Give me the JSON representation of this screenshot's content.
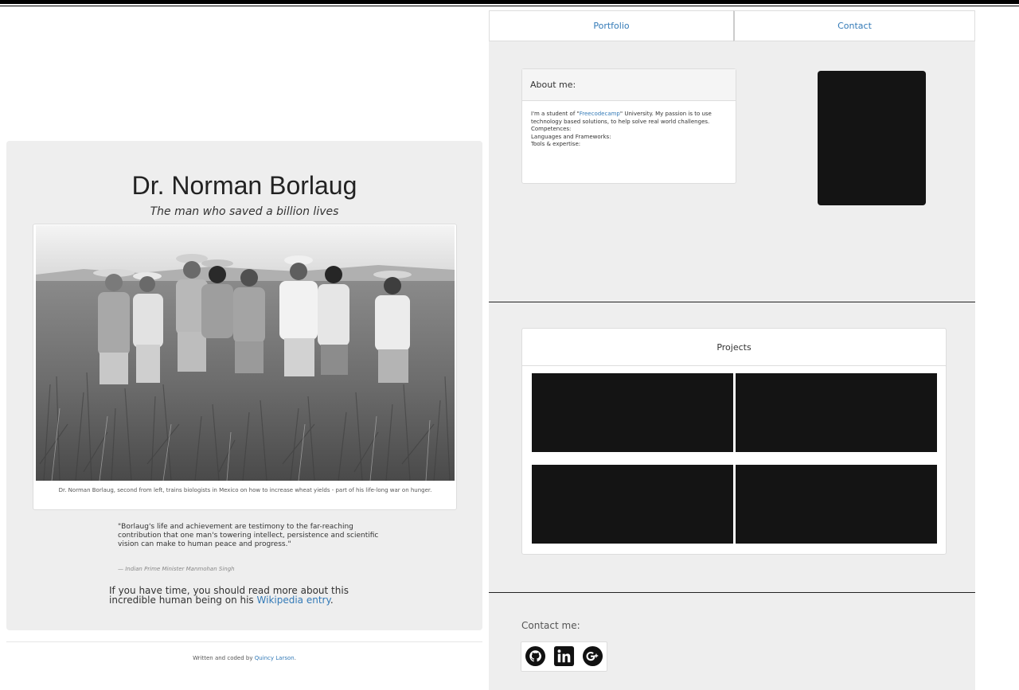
{
  "left": {
    "title": "Dr. Norman Borlaug",
    "subtitle": "The man who saved a billion lives",
    "caption": "Dr. Norman Borlaug, second from left, trains biologists in Mexico on how to increase wheat yields - part of his life-long war on hunger.",
    "quote": "\"Borlaug's life and achievement are testimony to the far-reaching contribution that one man's towering intellect, persistence and scientific vision can make to human peace and progress.\"",
    "quote_author": "— Indian Prime Minister Manmohan Singh",
    "more_info_prefix": "If you have time, you should read more about this incredible human being on his ",
    "more_info_link": "Wikipedia entry",
    "more_info_suffix": ".",
    "footer_prefix": "Written and coded by ",
    "footer_link": "Quincy Larson",
    "footer_suffix": "."
  },
  "nav": {
    "portfolio": "Portfolio",
    "contact": "Contact"
  },
  "about": {
    "heading": "About me:",
    "body_prefix": "I'm a student of \"",
    "body_link": "Freecodecamp",
    "body_suffix": "\" University. My passion is to use technology based solutions, to help solve real world challenges.",
    "competences": "Competences:",
    "languages": "Languages and Frameworks:",
    "tools": "Tools & expertise:"
  },
  "projects": {
    "heading": "Projects"
  },
  "contact": {
    "title": "Contact me:",
    "icons": [
      "github-icon",
      "linkedin-icon",
      "google-plus-icon"
    ]
  },
  "colors": {
    "link": "#337ab7",
    "panel": "#eeeeee",
    "dark_tile": "#141414"
  }
}
